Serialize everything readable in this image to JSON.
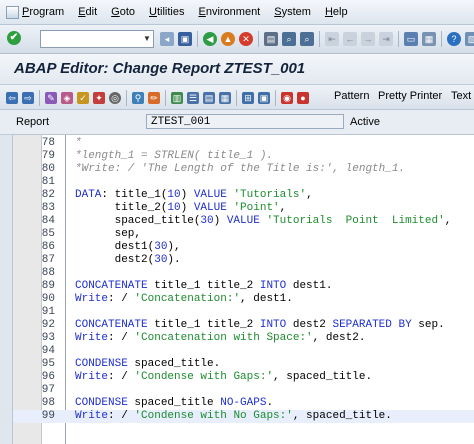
{
  "menu": [
    "Program",
    "Edit",
    "Goto",
    "Utilities",
    "Environment",
    "System",
    "Help"
  ],
  "command_field": {
    "value": "",
    "placeholder": ""
  },
  "title": "ABAP Editor: Change Report ZTEST_001",
  "app_toolbar": {
    "pattern": "Pattern",
    "pretty_printer": "Pretty Printer",
    "text": "Text"
  },
  "report": {
    "label": "Report",
    "value": "ZTEST_001",
    "status": "Active"
  },
  "icons": {
    "standard": [
      "check-icon",
      "save-icon",
      "back-icon",
      "exit-icon",
      "cancel-icon",
      "print-icon",
      "find-icon",
      "find-next-icon",
      "first-page-icon",
      "previous-page-icon",
      "next-page-icon",
      "last-page-icon",
      "new-session-icon",
      "shortcut-icon",
      "help-icon",
      "layout-icon"
    ],
    "application": [
      "back-arrow-icon",
      "forward-arrow-icon",
      "display-change-icon",
      "other-object-icon",
      "check-syntax-icon",
      "activate-icon",
      "test-icon",
      "where-used-icon",
      "object-list-icon",
      "navigation-window-icon",
      "hierarchy-icon",
      "screen-icon",
      "menu-painter-icon",
      "insert-statement-icon",
      "breakpoint-icon"
    ]
  },
  "code_lines": [
    {
      "n": "78",
      "text": "*"
    },
    {
      "n": "79",
      "text": "*length_1 = STRLEN( title_1 )."
    },
    {
      "n": "80",
      "text": "*Write: / 'The Length of the Title is:', length_1."
    },
    {
      "n": "81",
      "text": ""
    },
    {
      "n": "82",
      "text": "DATA: title_1(10) VALUE 'Tutorials',"
    },
    {
      "n": "83",
      "text": "      title_2(10) VALUE 'Point',"
    },
    {
      "n": "84",
      "text": "      spaced_title(30) VALUE 'Tutorials  Point  Limited',"
    },
    {
      "n": "85",
      "text": "      sep,"
    },
    {
      "n": "86",
      "text": "      dest1(30),"
    },
    {
      "n": "87",
      "text": "      dest2(30)."
    },
    {
      "n": "88",
      "text": ""
    },
    {
      "n": "89",
      "text": "CONCATENATE title_1 title_2 INTO dest1."
    },
    {
      "n": "90",
      "text": "Write: / 'Concatenation:', dest1."
    },
    {
      "n": "91",
      "text": ""
    },
    {
      "n": "92",
      "text": "CONCATENATE title_1 title_2 INTO dest2 SEPARATED BY sep."
    },
    {
      "n": "93",
      "text": "Write: / 'Concatenation with Space:', dest2."
    },
    {
      "n": "94",
      "text": ""
    },
    {
      "n": "95",
      "text": "CONDENSE spaced_title."
    },
    {
      "n": "96",
      "text": "Write: / 'Condense with Gaps:', spaced_title."
    },
    {
      "n": "97",
      "text": ""
    },
    {
      "n": "98",
      "text": "CONDENSE spaced_title NO-GAPS."
    },
    {
      "n": "99",
      "text": "Write: / 'Condense with No Gaps:', spaced_title."
    }
  ],
  "active_line": "99",
  "colors": {
    "keyword": "#1e2fd1",
    "comment": "#8a8a8a",
    "string": "#1d8c2f",
    "title": "#13233b"
  }
}
